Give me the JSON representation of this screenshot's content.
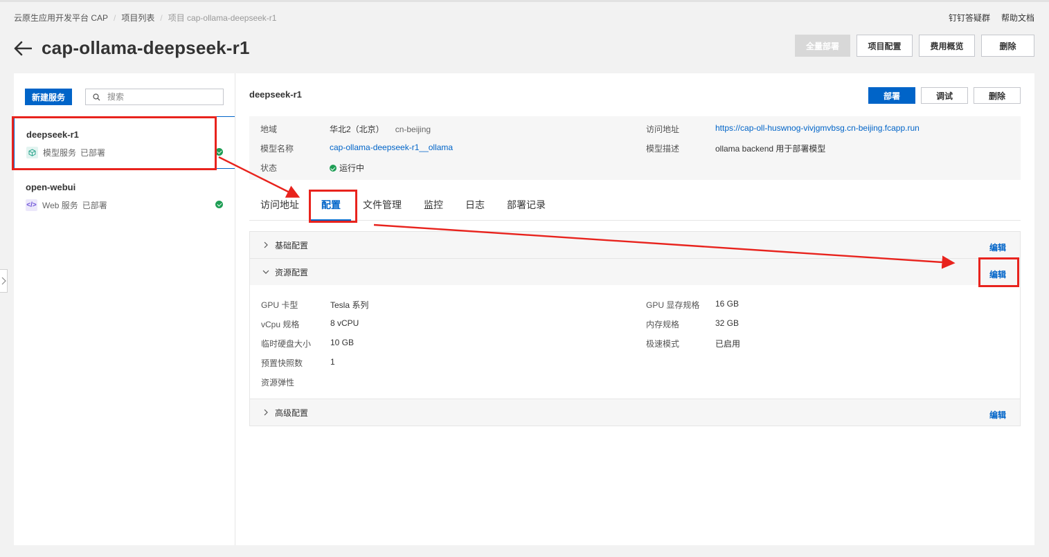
{
  "breadcrumb": {
    "platform": "云原生应用开发平台 CAP",
    "projects": "项目列表",
    "current": "项目 cap-ollama-deepseek-r1"
  },
  "top_links": {
    "dingtalk": "钉钉答疑群",
    "help": "帮助文档"
  },
  "page": {
    "title": "cap-ollama-deepseek-r1"
  },
  "header_buttons": {
    "deploy_all": "全量部署",
    "project_config": "项目配置",
    "cost_overview": "费用概览",
    "delete": "删除"
  },
  "sidebar": {
    "new_service": "新建服务",
    "search_placeholder": "搜索",
    "services": [
      {
        "name": "deepseek-r1",
        "type": "模型服务",
        "status": "已部署",
        "icon": "cube-icon",
        "active": true
      },
      {
        "name": "open-webui",
        "type": "Web 服务",
        "status": "已部署",
        "icon": "code-icon",
        "active": false
      }
    ]
  },
  "service": {
    "title": "deepseek-r1",
    "actions": {
      "deploy": "部署",
      "debug": "调试",
      "delete": "删除"
    },
    "info": {
      "region_label": "地域",
      "region_value": "华北2（北京）",
      "region_code": "cn-beijing",
      "url_label": "访问地址",
      "url_value": "https://cap-oll-huswnog-vivjgmvbsg.cn-beijing.fcapp.run",
      "model_name_label": "模型名称",
      "model_name_value": "cap-ollama-deepseek-r1__ollama",
      "model_desc_label": "模型描述",
      "model_desc_value": "ollama backend 用于部署模型",
      "status_label": "状态",
      "status_value": "运行中"
    }
  },
  "tabs": [
    "访问地址",
    "配置",
    "文件管理",
    "监控",
    "日志",
    "部署记录"
  ],
  "active_tab": "配置",
  "config": {
    "edit_label": "编辑",
    "sections": {
      "basic": "基础配置",
      "resource": "资源配置",
      "advanced": "高级配置"
    },
    "resource": {
      "gpu_type_label": "GPU 卡型",
      "gpu_type_value": "Tesla 系列",
      "gpu_mem_label": "GPU 显存规格",
      "gpu_mem_value": "16 GB",
      "vcpu_label": "vCpu 规格",
      "vcpu_value": "8 vCPU",
      "memory_label": "内存规格",
      "memory_value": "32 GB",
      "disk_label": "临时硬盘大小",
      "disk_value": "10 GB",
      "fast_mode_label": "极速模式",
      "fast_mode_value": "已启用",
      "snapshot_label": "预置快照数",
      "snapshot_value": "1",
      "elastic_label": "资源弹性"
    }
  },
  "colors": {
    "primary": "#0064c8",
    "success": "#1f9e55",
    "annotation": "#e8231d"
  }
}
